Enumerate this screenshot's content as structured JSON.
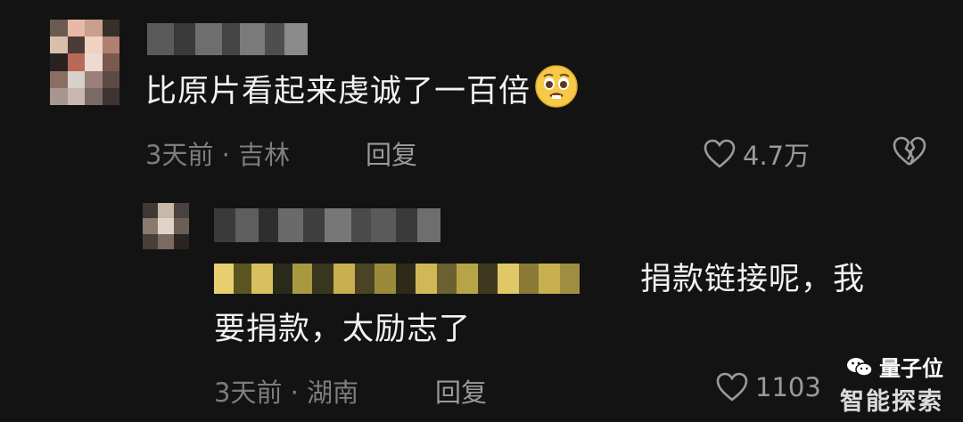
{
  "comment1": {
    "text": "比原片看起来虔诚了一百倍",
    "emoji": "pleading-face-emoji",
    "time": "3天前",
    "location": "吉林",
    "reply_label": "回复",
    "likes": "4.7万"
  },
  "comment2": {
    "text_line1": "捐款链接呢，我",
    "text_line2": "要捐款，太励志了",
    "time": "3天前",
    "location": "湖南",
    "reply_label": "回复",
    "likes": "1103"
  },
  "separator": "·",
  "watermark": {
    "brand": "量子位",
    "sub": "智能探索"
  },
  "colors": {
    "background": "#131313",
    "text": "#f2f2f2",
    "meta": "#7d7d7d",
    "action": "#9a9a9a"
  },
  "icons": [
    "heart-outline-icon",
    "broken-heart-icon",
    "wechat-icon"
  ]
}
